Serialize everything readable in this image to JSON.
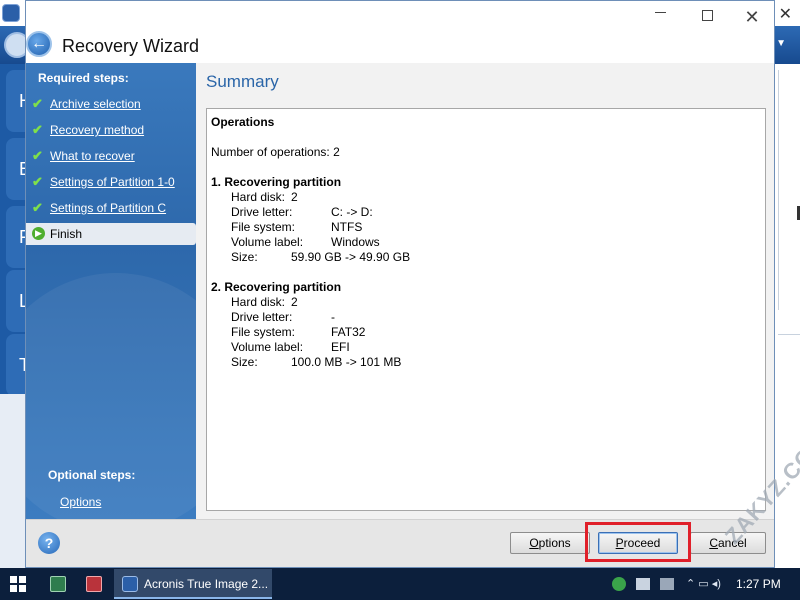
{
  "dialog": {
    "title": "Recovery Wizard"
  },
  "nav": {
    "required_heading": "Required steps:",
    "steps": [
      {
        "label": "Archive selection",
        "done": true
      },
      {
        "label": "Recovery method",
        "done": true
      },
      {
        "label": "What to recover",
        "done": true
      },
      {
        "label": "Settings of Partition 1-0",
        "done": true
      },
      {
        "label": "Settings of Partition C",
        "done": true
      },
      {
        "label": "Finish",
        "current": true
      }
    ],
    "optional_heading": "Optional steps:",
    "optional_items": [
      {
        "label": "Options"
      }
    ]
  },
  "summary": {
    "title": "Summary",
    "operations_heading": "Operations",
    "operations_count": "Number of operations: 2",
    "partitions": [
      {
        "heading": "1. Recovering partition",
        "hard_disk_label": "Hard disk:",
        "hard_disk": "2",
        "drive_letter_label": "Drive letter:",
        "drive_letter": "C: -> D:",
        "file_system_label": "File system:",
        "file_system": "NTFS",
        "volume_label_label": "Volume label:",
        "volume_label": "Windows",
        "size_label": "Size:",
        "size": "59.90 GB -> 49.90 GB"
      },
      {
        "heading": "2. Recovering partition",
        "hard_disk_label": "Hard disk:",
        "hard_disk": "2",
        "drive_letter_label": "Drive letter:",
        "drive_letter": "-",
        "file_system_label": "File system:",
        "file_system": "FAT32",
        "volume_label_label": "Volume label:",
        "volume_label": "EFI",
        "size_label": "Size:",
        "size": "100.0 MB -> 101 MB"
      }
    ]
  },
  "buttons": {
    "options_first": "O",
    "options_rest": "ptions",
    "proceed_first": "P",
    "proceed_rest": "roceed",
    "cancel_first": "C",
    "cancel_rest": "ancel"
  },
  "icons": {
    "back": "back-arrow-icon",
    "help": "help-icon",
    "check": "checkmark-icon",
    "current_step": "green-arrow-icon"
  },
  "colors": {
    "nav_blue": "#2d68ab",
    "title_blue": "#2a65a8",
    "check_green": "#7fe04a",
    "highlight_red": "#e0202a",
    "taskbar": "#0c1f3c"
  },
  "background_app": {
    "tile_letters": [
      "H",
      "E",
      "F",
      "L",
      "T"
    ]
  },
  "watermark": "ZAKYZ.COM",
  "taskbar": {
    "app_label": "Acronis True Image 2...",
    "clock": "1:27 PM"
  }
}
